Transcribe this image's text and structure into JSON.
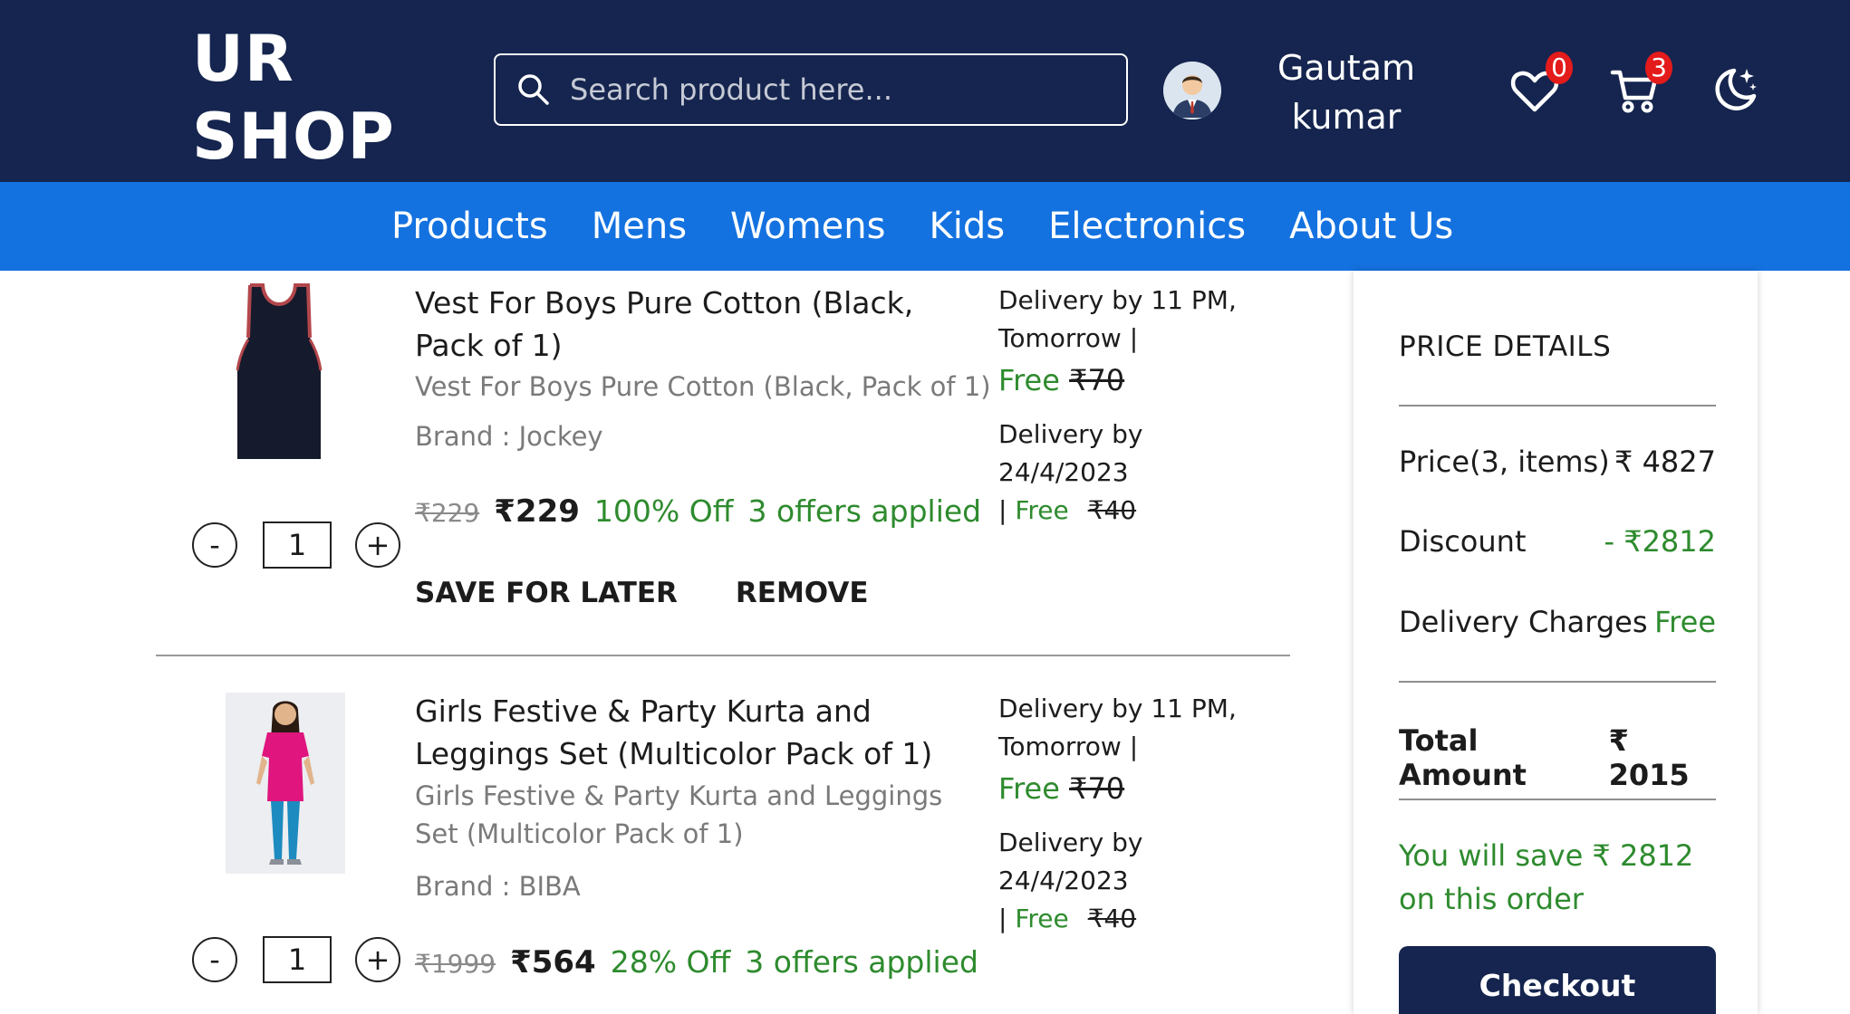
{
  "header": {
    "logo_line1": "UR",
    "logo_line2": "SHOP",
    "search_placeholder": "Search product here...",
    "user_first": "Gautam",
    "user_last": "kumar",
    "wishlist_count": "0",
    "cart_count": "3",
    "icons": [
      "search-icon",
      "avatar",
      "heart-icon",
      "cart-icon",
      "moon-icon"
    ]
  },
  "nav": {
    "items": [
      "Products",
      "Mens",
      "Womens",
      "Kids",
      "Electronics",
      "About Us"
    ]
  },
  "cart": {
    "items": [
      {
        "title": "Vest For Boys Pure Cotton (Black, Pack of 1)",
        "subtitle": "Vest For Boys Pure Cotton (Black, Pack of 1)",
        "brand": "Brand : Jockey",
        "mrp": "₹229",
        "price": "₹229",
        "discount": "100% Off",
        "offers": "3 offers applied",
        "quantity": "1",
        "save_for_later": "SAVE FOR LATER",
        "remove": "REMOVE",
        "delivery1_line1": "Delivery by 11 PM,",
        "delivery1_line2": "Tomorrow |",
        "delivery1_free": "Free",
        "delivery1_fee": "₹70",
        "delivery2_line1": "Delivery by",
        "delivery2_line2": "24/4/2023",
        "delivery2_sep": "|",
        "delivery2_free": "Free",
        "delivery2_fee": "₹40"
      },
      {
        "title": "Girls Festive & Party Kurta and Leggings Set (Multicolor Pack of 1)",
        "subtitle": "Girls Festive & Party Kurta and Leggings Set (Multicolor Pack of 1)",
        "brand": "Brand : BIBA",
        "mrp": "₹1999",
        "price": "₹564",
        "discount": "28% Off",
        "offers": "3 offers applied",
        "quantity": "1",
        "delivery1_line1": "Delivery by 11 PM,",
        "delivery1_line2": "Tomorrow |",
        "delivery1_free": "Free",
        "delivery1_fee": "₹70",
        "delivery2_line1": "Delivery by",
        "delivery2_line2": "24/4/2023",
        "delivery2_sep": "|",
        "delivery2_free": "Free",
        "delivery2_fee": "₹40"
      }
    ]
  },
  "price_details": {
    "title": "PRICE DETAILS",
    "price_label": "Price(3, items)",
    "price_value": "₹ 4827",
    "discount_label": "Discount",
    "discount_value": "- ₹2812",
    "delivery_label": "Delivery Charges",
    "delivery_value": "Free",
    "total_label": "Total Amount",
    "total_value": "₹ 2015",
    "save_text": "You will save ₹ 2812 on this order",
    "checkout_label": "Checkout"
  },
  "colors": {
    "header_bg": "#15254f",
    "nav_bg": "#1472e0",
    "green": "#2e8b2e",
    "badge": "#e41b1b"
  }
}
